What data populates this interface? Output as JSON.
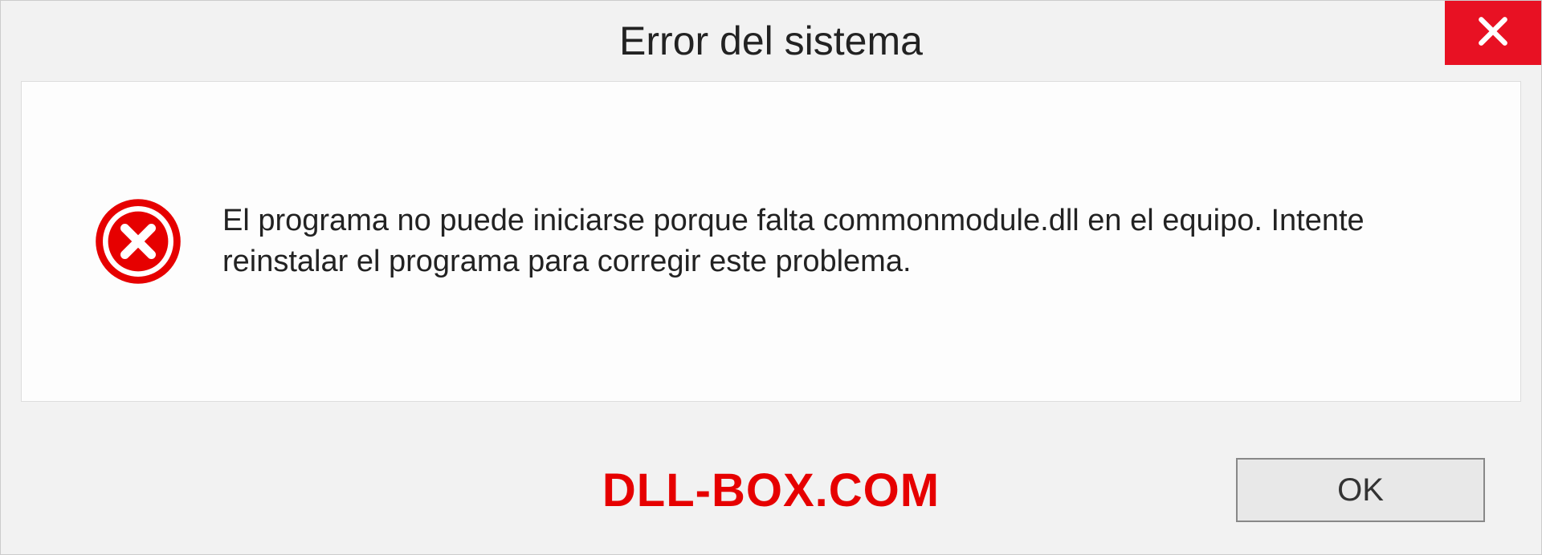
{
  "dialog": {
    "title": "Error del sistema",
    "message": "El programa no puede iniciarse porque falta commonmodule.dll en el equipo. Intente reinstalar el programa para corregir este problema.",
    "ok_label": "OK"
  },
  "watermark": "DLL-BOX.COM",
  "colors": {
    "close_red": "#e81123",
    "error_red": "#e60000",
    "watermark_red": "#e60000"
  }
}
